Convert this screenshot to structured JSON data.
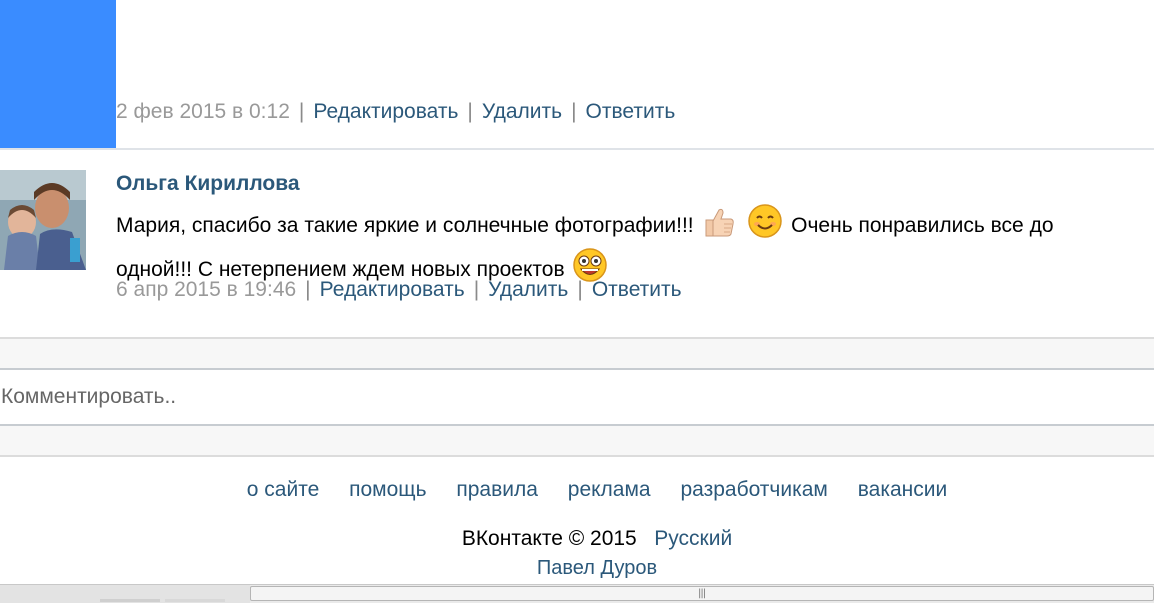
{
  "top_comment": {
    "date": "2 фев 2015 в 0:12",
    "edit_label": "Редактировать",
    "delete_label": "Удалить",
    "reply_label": "Ответить"
  },
  "second_comment": {
    "author": "Ольга Кириллова",
    "text_part1": "Мария, спасибо за такие яркие и солнечные фотографии!!!",
    "emoji1": "thumbs-up",
    "emoji2": "smile",
    "text_part2": "Очень понравились все до одной!!! С нетерпением ждем новых проектов",
    "emoji3": "wide-eyed-grin",
    "date": "6 апр 2015 в 19:46",
    "edit_label": "Редактировать",
    "delete_label": "Удалить",
    "reply_label": "Ответить"
  },
  "comment_box": {
    "placeholder": "Комментировать.."
  },
  "footer": {
    "links": [
      "о сайте",
      "помощь",
      "правила",
      "реклама",
      "разработчикам",
      "вакансии"
    ],
    "copyright": "ВКонтакте © 2015",
    "language": "Русский",
    "author": "Павел Дуров"
  },
  "colors": {
    "link": "#2b587a",
    "meta": "#999999",
    "avatar_blue": "#3a8cff"
  }
}
